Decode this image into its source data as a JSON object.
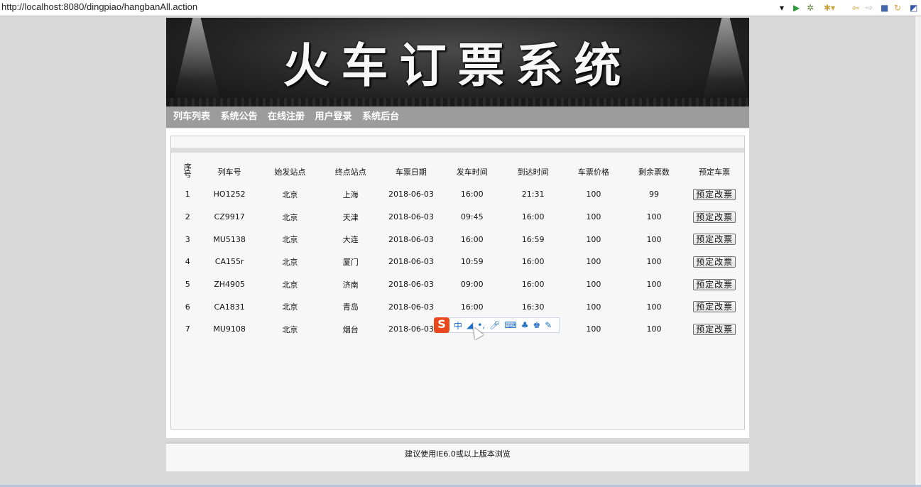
{
  "browser": {
    "url": "http://localhost:8080/dingpiao/hangbanAll.action",
    "toolbar_icons": [
      "dropdown-icon",
      "play-icon",
      "debug-icon",
      "run-config-icon",
      "back-icon",
      "forward-icon",
      "stop-icon",
      "refresh-icon"
    ]
  },
  "site": {
    "title": "火车订票系统",
    "nav": [
      "列车列表",
      "系统公告",
      "在线注册",
      "用户登录",
      "系统后台"
    ],
    "footer": "建议使用IE6.0或以上版本浏览"
  },
  "table": {
    "headers": [
      "序号",
      "列车号",
      "始发站点",
      "终点站点",
      "车票日期",
      "发车时间",
      "到达时间",
      "车票价格",
      "剩余票数",
      "预定车票"
    ],
    "rows": [
      {
        "seq": "1",
        "train": "HO1252",
        "from": "北京",
        "to": "上海",
        "date": "2018-06-03",
        "depart": "16:00",
        "arrive": "21:31",
        "price": "100",
        "left": "99",
        "action": "预定改票"
      },
      {
        "seq": "2",
        "train": "CZ9917",
        "from": "北京",
        "to": "天津",
        "date": "2018-06-03",
        "depart": "09:45",
        "arrive": "16:00",
        "price": "100",
        "left": "100",
        "action": "预定改票"
      },
      {
        "seq": "3",
        "train": "MU5138",
        "from": "北京",
        "to": "大连",
        "date": "2018-06-03",
        "depart": "16:00",
        "arrive": "16:59",
        "price": "100",
        "left": "100",
        "action": "预定改票"
      },
      {
        "seq": "4",
        "train": "CA155r",
        "from": "北京",
        "to": "厦门",
        "date": "2018-06-03",
        "depart": "10:59",
        "arrive": "16:00",
        "price": "100",
        "left": "100",
        "action": "预定改票"
      },
      {
        "seq": "5",
        "train": "ZH4905",
        "from": "北京",
        "to": "济南",
        "date": "2018-06-03",
        "depart": "09:00",
        "arrive": "16:00",
        "price": "100",
        "left": "100",
        "action": "预定改票"
      },
      {
        "seq": "6",
        "train": "CA1831",
        "from": "北京",
        "to": "青岛",
        "date": "2018-06-03",
        "depart": "16:00",
        "arrive": "16:30",
        "price": "100",
        "left": "100",
        "action": "预定改票"
      },
      {
        "seq": "7",
        "train": "MU9108",
        "from": "北京",
        "to": "烟台",
        "date": "2018-06-03",
        "depart": "",
        "arrive": "",
        "price": "100",
        "left": "100",
        "action": "预定改票"
      }
    ]
  },
  "ime": {
    "logo": "S",
    "mode": "中"
  }
}
